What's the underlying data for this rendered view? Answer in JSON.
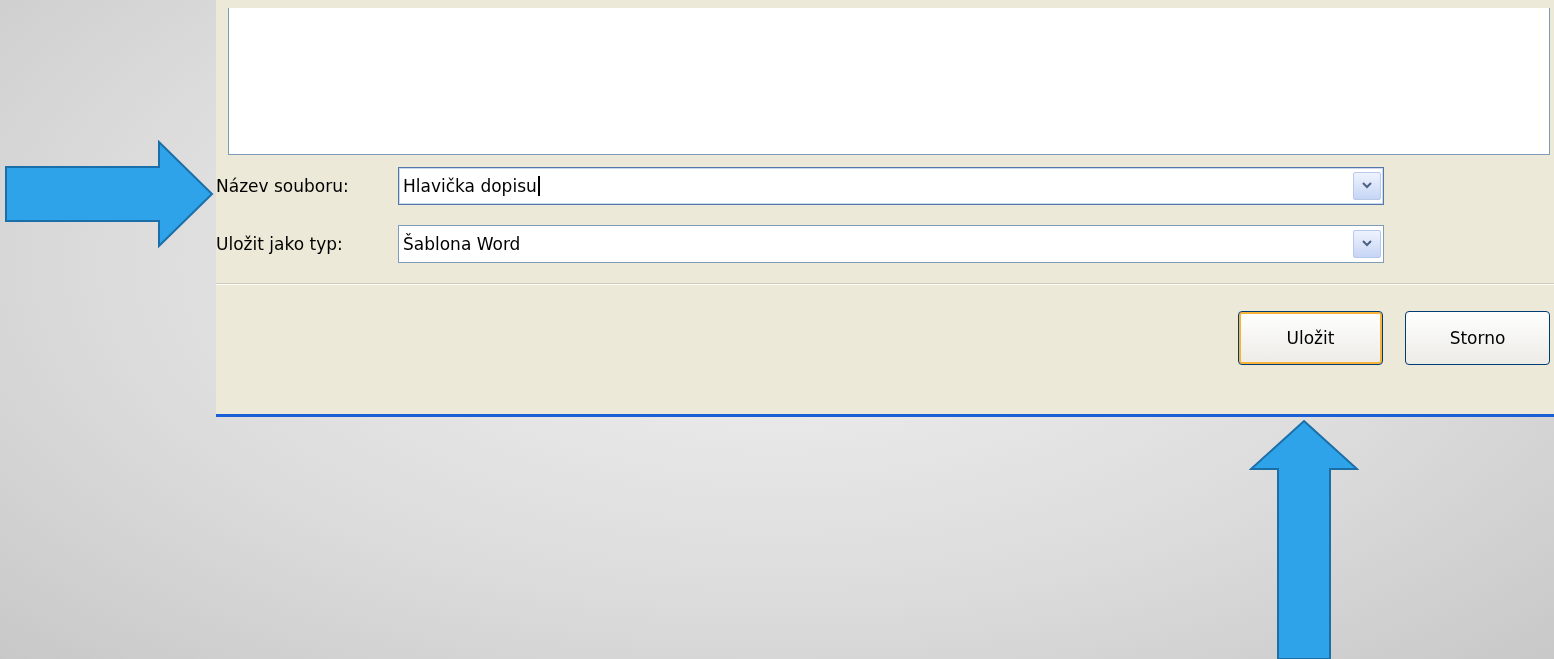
{
  "dialog": {
    "fields": [
      {
        "label": "Název souboru:",
        "value": "Hlavička dopisu",
        "focused": true
      },
      {
        "label": "Uložit jako typ:",
        "value": "Šablona Word",
        "focused": false
      }
    ],
    "buttons": [
      {
        "label": "Uložit",
        "default": true
      },
      {
        "label": "Storno",
        "default": false
      }
    ]
  }
}
